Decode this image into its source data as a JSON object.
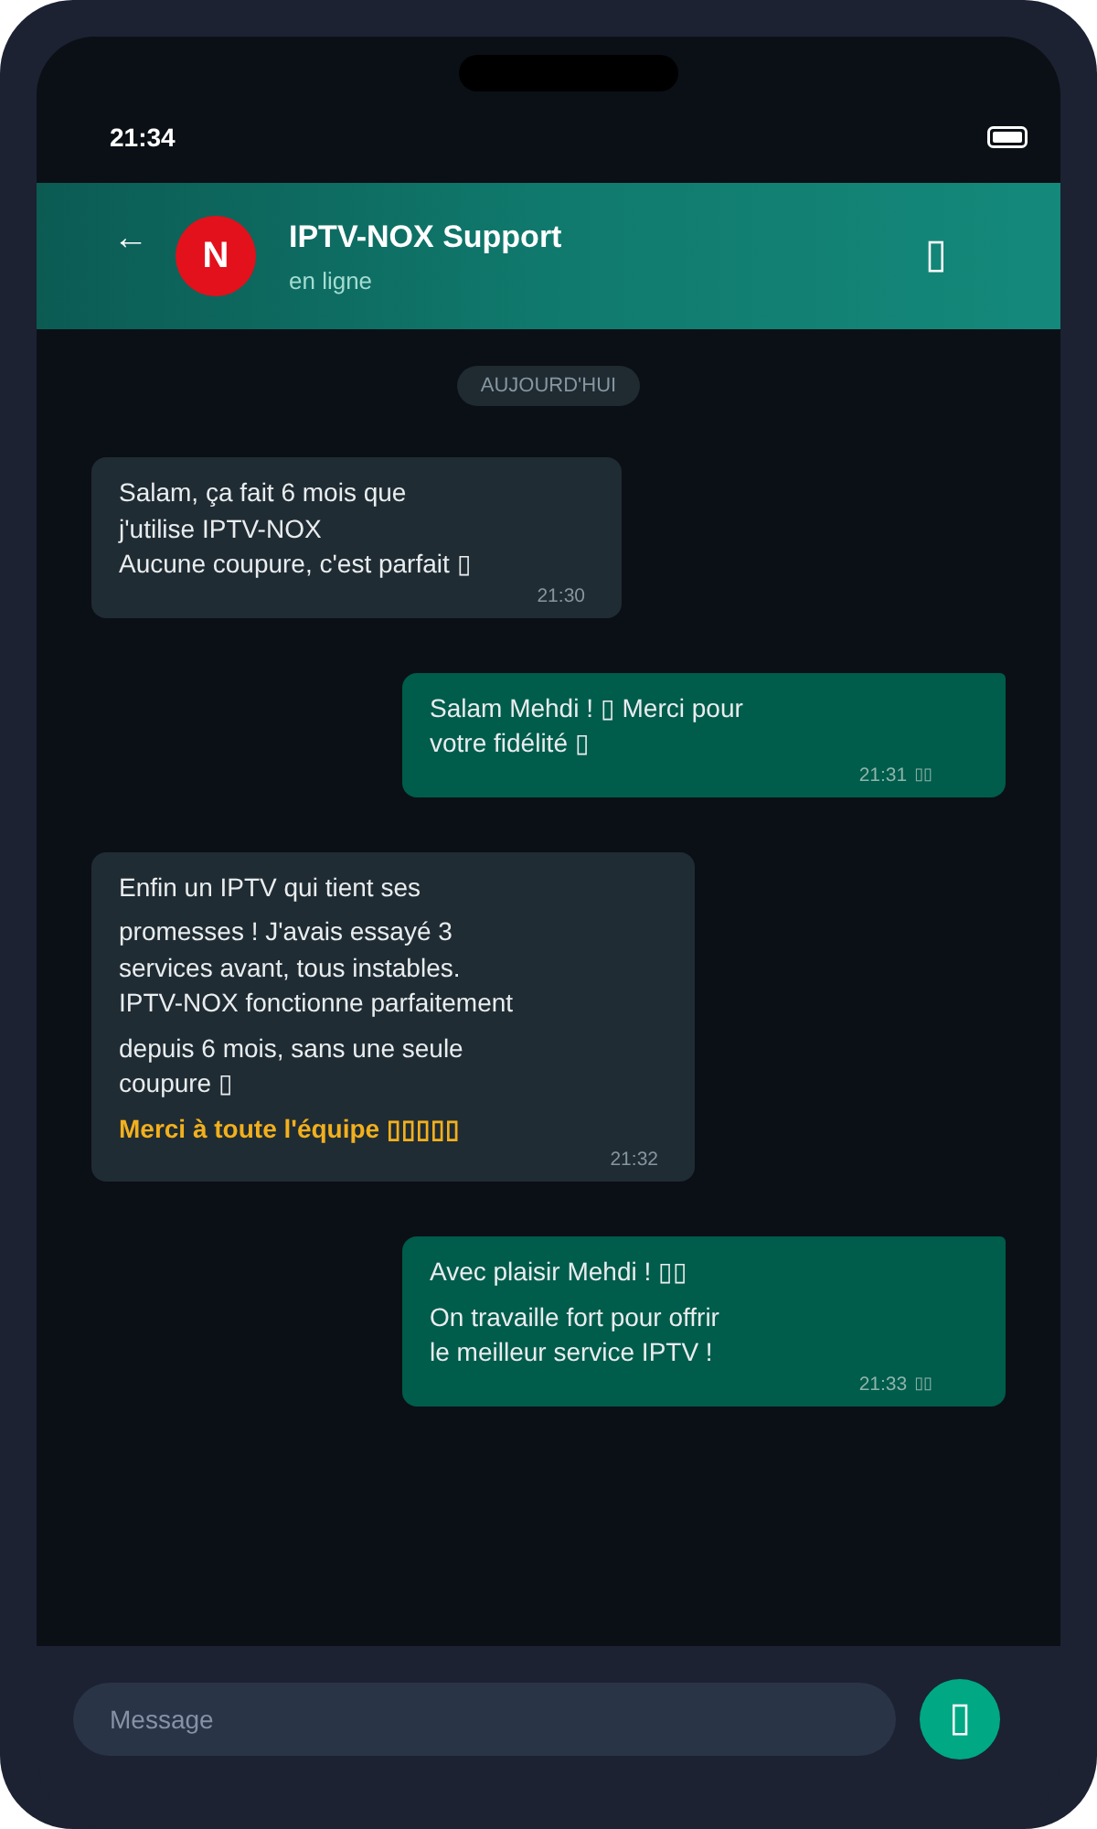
{
  "status_bar": {
    "time": "21:34"
  },
  "header": {
    "back": "←",
    "avatar_letter": "N",
    "title": "IPTV-NOX Support",
    "subtitle": "en ligne",
    "action": "▯"
  },
  "date_chip": "AUJOURD'HUI",
  "messages": [
    {
      "kind": "received",
      "paragraphs": [
        {
          "kind": "plain",
          "text": "Salam, ça fait 6 mois que\nj'utilise IPTV-NOX\nAucune coupure, c'est parfait ▯"
        }
      ],
      "time": "21:30"
    },
    {
      "kind": "sent",
      "paragraphs": [
        {
          "kind": "plain",
          "text": "Salam Mehdi ! ▯ Merci pour\nvotre fidélité ▯"
        }
      ],
      "time": "21:31",
      "status": "▯▯"
    },
    {
      "kind": "received",
      "paragraphs": [
        {
          "kind": "plain",
          "text": "Enfin un IPTV qui tient ses"
        },
        {
          "kind": "plain",
          "text": "promesses ! J'avais essayé 3\nservices avant, tous instables.\nIPTV-NOX fonctionne parfaitement"
        },
        {
          "kind": "plain",
          "text": "depuis 6 mois, sans une seule\ncoupure ▯"
        },
        {
          "kind": "highlight",
          "text": "Merci à toute l'équipe ▯▯▯▯▯"
        }
      ],
      "time": "21:32"
    },
    {
      "kind": "sent",
      "paragraphs": [
        {
          "kind": "plain",
          "text": "Avec plaisir Mehdi ! ▯▯"
        },
        {
          "kind": "plain",
          "text": "On travaille fort pour offrir\nle meilleur service IPTV !"
        }
      ],
      "time": "21:33",
      "status": "▯▯"
    }
  ],
  "composer": {
    "placeholder": "Message",
    "send": "▯"
  }
}
